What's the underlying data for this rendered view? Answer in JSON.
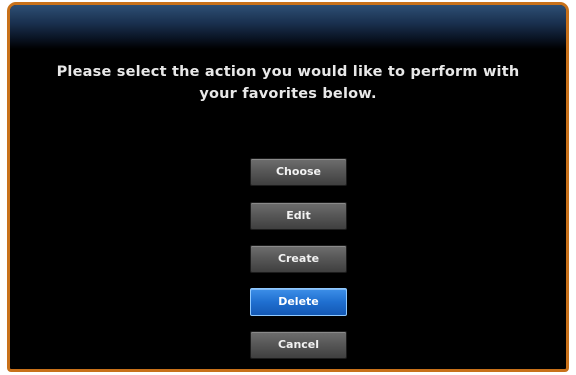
{
  "prompt": {
    "line1": "Please select the action you would like to perform with",
    "line2": "your favorites below."
  },
  "buttons": [
    {
      "id": "choose",
      "label": "Choose",
      "selected": false
    },
    {
      "id": "edit",
      "label": "Edit",
      "selected": false
    },
    {
      "id": "create",
      "label": "Create",
      "selected": false
    },
    {
      "id": "delete",
      "label": "Delete",
      "selected": true
    },
    {
      "id": "cancel",
      "label": "Cancel",
      "selected": false
    }
  ],
  "colors": {
    "frame_border": "#c8711a",
    "background": "#000000",
    "selected_button": "#1f6fd0",
    "button": "#585858",
    "text": "#e8e8e8"
  }
}
